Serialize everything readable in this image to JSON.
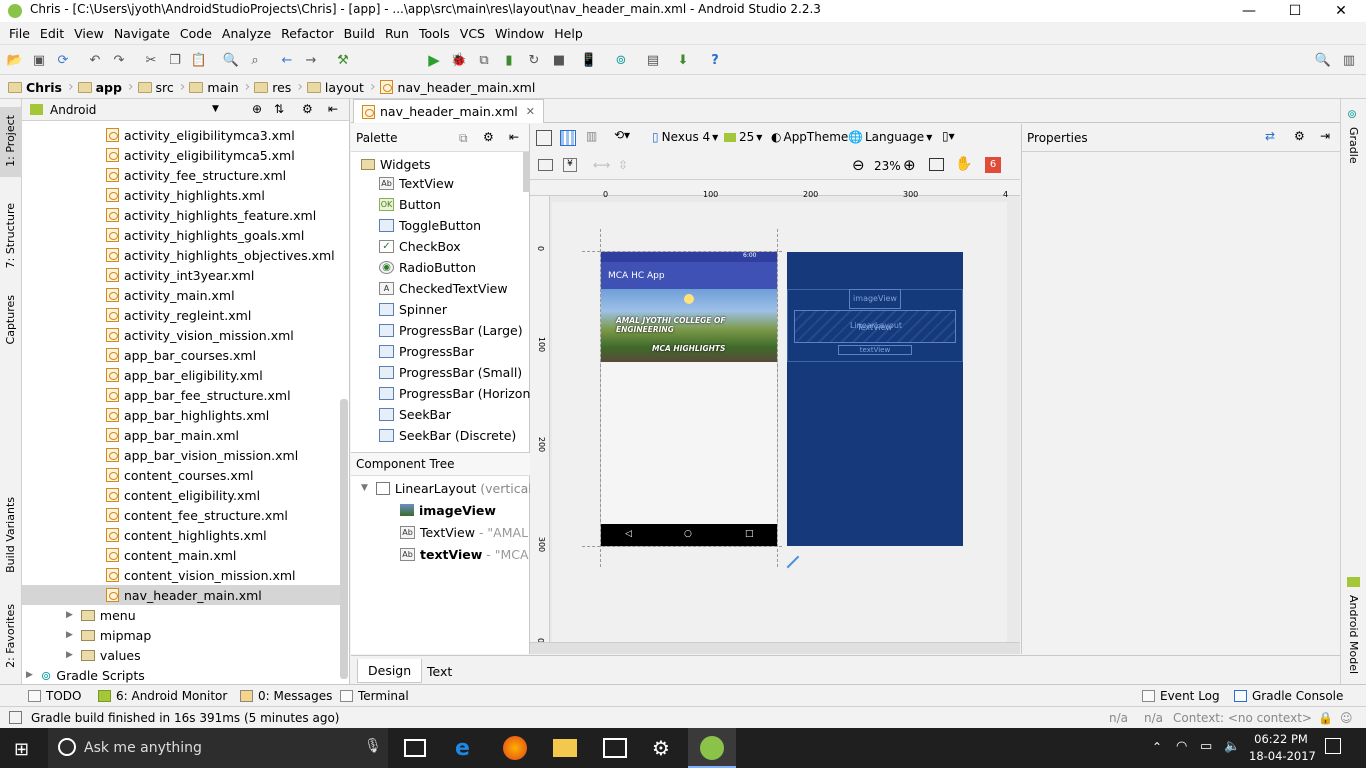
{
  "window": {
    "title": "Chris - [C:\\Users\\jyoth\\AndroidStudioProjects\\Chris] - [app] - ...\\app\\src\\main\\res\\layout\\nav_header_main.xml - Android Studio 2.2.3",
    "minimize": "—",
    "maximize": "☐",
    "close": "✕"
  },
  "menu": [
    "File",
    "Edit",
    "View",
    "Navigate",
    "Code",
    "Analyze",
    "Refactor",
    "Build",
    "Run",
    "Tools",
    "VCS",
    "Window",
    "Help"
  ],
  "toolbar": {
    "run_config": "app"
  },
  "breadcrumb": [
    "Chris",
    "app",
    "src",
    "main",
    "res",
    "layout",
    "nav_header_main.xml"
  ],
  "left_strip": {
    "project": "1: Project",
    "structure": "7: Structure",
    "captures": "Captures",
    "build_variants": "Build Variants",
    "favorites": "2: Favorites"
  },
  "right_strip": {
    "gradle": "Gradle",
    "android_model": "Android Model"
  },
  "project": {
    "view_mode": "Android",
    "files": [
      "activity_eligibilitymca3.xml",
      "activity_eligibilitymca5.xml",
      "activity_fee_structure.xml",
      "activity_highlights.xml",
      "activity_highlights_feature.xml",
      "activity_highlights_goals.xml",
      "activity_highlights_objectives.xml",
      "activity_int3year.xml",
      "activity_main.xml",
      "activity_regleint.xml",
      "activity_vision_mission.xml",
      "app_bar_courses.xml",
      "app_bar_eligibility.xml",
      "app_bar_fee_structure.xml",
      "app_bar_highlights.xml",
      "app_bar_main.xml",
      "app_bar_vision_mission.xml",
      "content_courses.xml",
      "content_eligibility.xml",
      "content_fee_structure.xml",
      "content_highlights.xml",
      "content_main.xml",
      "content_vision_mission.xml",
      "nav_header_main.xml"
    ],
    "folders": [
      "menu",
      "mipmap",
      "values"
    ],
    "gradle_scripts": "Gradle Scripts"
  },
  "editor_tab": "nav_header_main.xml",
  "palette": {
    "title": "Palette",
    "group": "Widgets",
    "items": [
      {
        "icon": "Ab",
        "label": "TextView"
      },
      {
        "icon": "OK",
        "label": "Button"
      },
      {
        "icon": "",
        "label": "ToggleButton"
      },
      {
        "icon": "✓",
        "label": "CheckBox"
      },
      {
        "icon": "◉",
        "label": "RadioButton"
      },
      {
        "icon": "A",
        "label": "CheckedTextView"
      },
      {
        "icon": "",
        "label": "Spinner"
      },
      {
        "icon": "",
        "label": "ProgressBar (Large)"
      },
      {
        "icon": "",
        "label": "ProgressBar"
      },
      {
        "icon": "",
        "label": "ProgressBar (Small)"
      },
      {
        "icon": "",
        "label": "ProgressBar (Horizontal)"
      },
      {
        "icon": "",
        "label": "SeekBar"
      },
      {
        "icon": "",
        "label": "SeekBar (Discrete)"
      }
    ]
  },
  "component_tree": {
    "title": "Component Tree",
    "root": "LinearLayout",
    "root_hint": "(vertical)",
    "children": [
      {
        "name": "imageView",
        "hint": ""
      },
      {
        "name": "TextView",
        "hint": "- \"AMAL JY"
      },
      {
        "name": "textView",
        "hint": "- \"MCA HI"
      }
    ]
  },
  "design_toolbar": {
    "device": "Nexus 4",
    "api": "25",
    "theme": "AppTheme",
    "language": "Language",
    "zoom": "23%",
    "warnings": "6"
  },
  "ruler": {
    "h": [
      "0",
      "100",
      "200",
      "300",
      "4"
    ],
    "v": [
      "0",
      "100",
      "200",
      "300",
      "0"
    ]
  },
  "preview": {
    "app_title": "MCA HC App",
    "clock": "6:00",
    "college": "AMAL JYOTHI COLLEGE OF ENGINEERING",
    "subtitle": "MCA HIGHLIGHTS",
    "blueprint": {
      "image": "imageView",
      "layout": "LinearLayout",
      "text1": "TextView",
      "text2": "textView"
    },
    "colors": {
      "primary": "#3f51b5",
      "blueprint": "#15397a"
    }
  },
  "properties": {
    "title": "Properties"
  },
  "bottom_tabs": [
    "Design",
    "Text"
  ],
  "tool_windows": [
    "TODO",
    "6: Android Monitor",
    "0: Messages",
    "Terminal",
    "Event Log",
    "Gradle Console"
  ],
  "status": {
    "message": "Gradle build finished in 16s 391ms (5 minutes ago)",
    "na1": "n/a",
    "na2": "n/a",
    "context": "Context: <no context>"
  },
  "taskbar": {
    "search_placeholder": "Ask me anything",
    "time": "06:22 PM",
    "date": "18-04-2017"
  }
}
